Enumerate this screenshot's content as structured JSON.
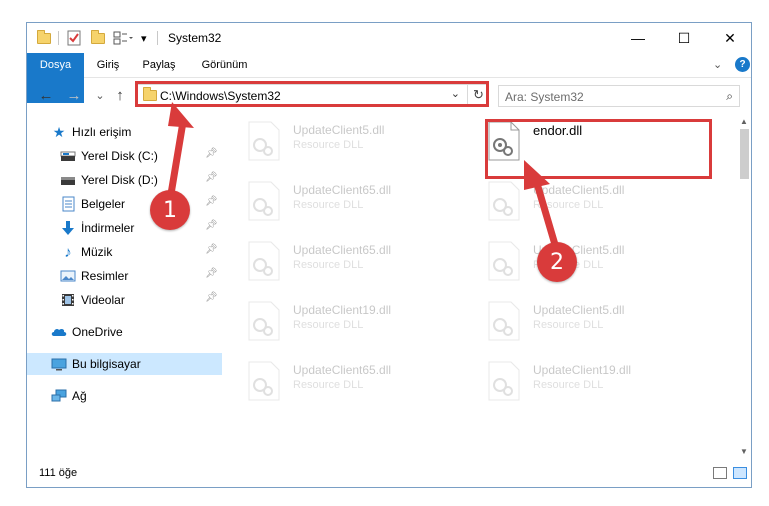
{
  "window": {
    "title": "System32",
    "controls": {
      "minimize": "—",
      "maximize": "☐",
      "close": "✕"
    }
  },
  "ribbon": {
    "tabs": [
      "Dosya",
      "Giriş",
      "Paylaş",
      "Görünüm"
    ],
    "expand_icon": "chevron-down-icon",
    "help_icon": "?"
  },
  "address_bar": {
    "path": "C:\\Windows\\System32",
    "dropdown": "⌄",
    "refresh": "↻"
  },
  "search": {
    "placeholder": "Ara: System32",
    "icon": "⌕"
  },
  "nav": {
    "back": "←",
    "forward": "→",
    "recent": "⌄",
    "up": "↑"
  },
  "sidebar": {
    "quick_access": "Hızlı erişim",
    "pinned": [
      {
        "label": "Yerel Disk (C:)",
        "icon": "drive-icon"
      },
      {
        "label": "Yerel Disk (D:)",
        "icon": "drive-icon"
      },
      {
        "label": "Belgeler",
        "icon": "documents-icon"
      },
      {
        "label": "İndirmeler",
        "icon": "downloads-icon"
      },
      {
        "label": "Müzik",
        "icon": "music-icon"
      },
      {
        "label": "Resimler",
        "icon": "pictures-icon"
      },
      {
        "label": "Videolar",
        "icon": "videos-icon"
      }
    ],
    "onedrive": "OneDrive",
    "this_pc": "Bu bilgisayar",
    "network": "Ağ"
  },
  "files": {
    "highlighted": {
      "name": "endor.dll",
      "description": ""
    },
    "items": [
      {
        "name": "UpdateClient5.dll",
        "description": "Resource DLL"
      },
      {
        "name": "UpdateClient65.dll",
        "description": "Resource DLL"
      },
      {
        "name": "UpdateClient5.dll",
        "description": "Resource DLL"
      },
      {
        "name": "UpdateClient65.dll",
        "description": "Resource DLL"
      },
      {
        "name": "UpdateClient5.dll",
        "description": "Resource DLL"
      },
      {
        "name": "UpdateClient19.dll",
        "description": "Resource DLL"
      },
      {
        "name": "UpdateClient5.dll",
        "description": "Resource DLL"
      },
      {
        "name": "UpdateClient65.dll",
        "description": "Resource DLL"
      },
      {
        "name": "UpdateClient19.dll",
        "description": "Resource DLL"
      }
    ]
  },
  "status": {
    "item_count": "111 öğe"
  },
  "annotations": {
    "step1": "1",
    "step2": "2",
    "highlight_color": "#d93b3b"
  },
  "colors": {
    "accent": "#1979ca",
    "selected": "#cce8ff"
  }
}
